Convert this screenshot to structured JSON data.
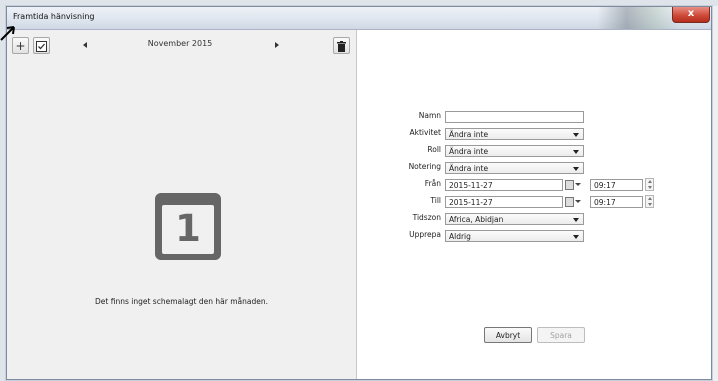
{
  "window": {
    "title": "Framtida hänvisning",
    "close_label": "x"
  },
  "toolbar": {
    "add_label": "+",
    "month_label": "November 2015"
  },
  "empty": {
    "day_number": "1",
    "message": "Det finns inget schemalagt den här månaden."
  },
  "form": {
    "name": {
      "label": "Namn",
      "value": ""
    },
    "activity": {
      "label": "Aktivitet",
      "value": "Ändra inte"
    },
    "role": {
      "label": "Roll",
      "value": "Ändra inte"
    },
    "note": {
      "label": "Notering",
      "value": "Ändra inte"
    },
    "from": {
      "label": "Från",
      "date": "2015-11-27",
      "time": "09:17"
    },
    "to": {
      "label": "Till",
      "date": "2015-11-27",
      "time": "09:17"
    },
    "timezone": {
      "label": "Tidszon",
      "value": "Africa, Abidjan"
    },
    "repeat": {
      "label": "Upprepa",
      "value": "Aldrig"
    }
  },
  "buttons": {
    "cancel": "Avbryt",
    "save": "Spara"
  },
  "colors": {
    "accent": "#c9463a",
    "empty_icon": "#666666"
  }
}
